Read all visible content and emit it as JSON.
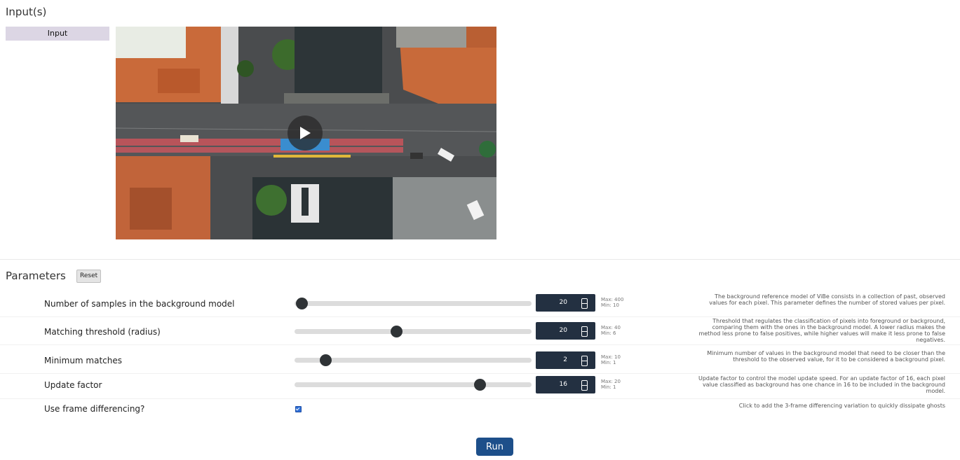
{
  "inputs": {
    "title": "Input(s)",
    "tab_label": "Input"
  },
  "video": {
    "play_icon": "play-icon"
  },
  "parameters": {
    "title": "Parameters",
    "reset_label": "Reset",
    "rows": [
      {
        "label": "Number of samples in the background model",
        "value": "20",
        "max": "Max: 400",
        "min": "Min: 10",
        "slider_fraction": 0.03,
        "description": "The background reference model of ViBe consists in a collection of past, observed values for each pixel. This parameter defines the number of stored values per pixel."
      },
      {
        "label": "Matching threshold (radius)",
        "value": "20",
        "max": "Max: 40",
        "min": "Min: 6",
        "slider_fraction": 0.43,
        "description": "Threshold that regulates the classification of pixels into foreground or background, comparing them with the ones in the background model. A lower radius makes the method less prone to false positives, while higher values will make it less prone to false negatives."
      },
      {
        "label": "Minimum matches",
        "value": "2",
        "max": "Max: 10",
        "min": "Min: 1",
        "slider_fraction": 0.13,
        "description": "Minimum number of values in the background model that need to be closer than the threshold to the observed value, for it to be considered a background pixel."
      },
      {
        "label": "Update factor",
        "value": "16",
        "max": "Max: 20",
        "min": "Min: 1",
        "slider_fraction": 0.78,
        "description": "Update factor to control the model update speed. For an update factor of 16, each pixel value classified as background has one chance in 16 to be included in the background model."
      }
    ],
    "checkbox_row": {
      "label": "Use frame differencing?",
      "checked": true,
      "description": "Click to add the 3-frame differencing variation to quickly dissipate ghosts"
    }
  },
  "run_label": "Run",
  "colors": {
    "accent": "#1d4f8a",
    "input_box": "#233041",
    "tab": "#dcd6e4"
  }
}
